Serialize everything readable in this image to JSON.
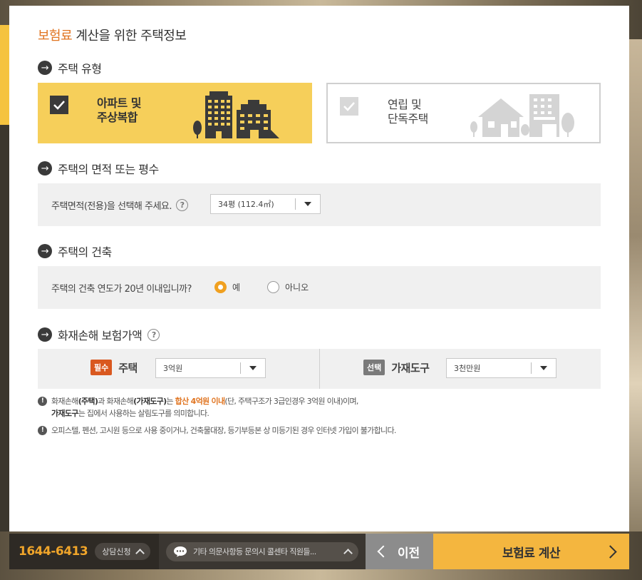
{
  "title": {
    "accent": "보험료",
    "rest": " 계산을 위한 주택정보"
  },
  "house_type": {
    "heading": "주택 유형",
    "options": [
      {
        "line1": "아파트 및",
        "line2": "주상복합",
        "selected": true
      },
      {
        "line1": "연립 및",
        "line2": "단독주택",
        "selected": false
      }
    ]
  },
  "area": {
    "heading": "주택의 면적 또는 평수",
    "label": "주택면적(전용)을 선택해 주세요.",
    "help_icon": "question-icon",
    "selected": "34평 (112.4㎡)"
  },
  "construction": {
    "heading": "주택의 건축",
    "question": "주택의 건축 연도가 20년 이내입니까?",
    "options": [
      {
        "label": "예",
        "selected": true
      },
      {
        "label": "아니오",
        "selected": false
      }
    ]
  },
  "coverage": {
    "heading": "화재손해 보험가액",
    "help_icon": "question-icon",
    "required_badge": "필수",
    "house_label": "주택",
    "house_value": "3억원",
    "optional_badge": "선택",
    "goods_label": "가재도구",
    "goods_value": "3천만원"
  },
  "notes": {
    "n1_a": "화재손해",
    "n1_b": "(주택)",
    "n1_c": "과 화재손해",
    "n1_d": "(가재도구)",
    "n1_e": "는 ",
    "n1_hl": "합산 4억원 이내",
    "n1_f": "(단, 주택구조가 3급인경우 3억원 이내)이며,",
    "n1_g": "가재도구",
    "n1_h": "는 집에서 사용하는 살림도구를 의미합니다.",
    "n2": "오피스텔, 펜션, 고시원 등으로 사용 중이거나, 건축물대장, 등기부등본 상 미등기된 경우 인터넷 가입이 불가합니다."
  },
  "bottom": {
    "phone": "1644-6413",
    "consult": "상담신청",
    "chat": "기타 의문사항등 문의시 콜센타 직원들...",
    "prev": "이전",
    "calc": "보험료 계산"
  },
  "colors": {
    "accent": "#e07420",
    "card_selected": "#f6cf5a",
    "calc_button": "#f4b63f",
    "required_badge": "#d9581f"
  }
}
